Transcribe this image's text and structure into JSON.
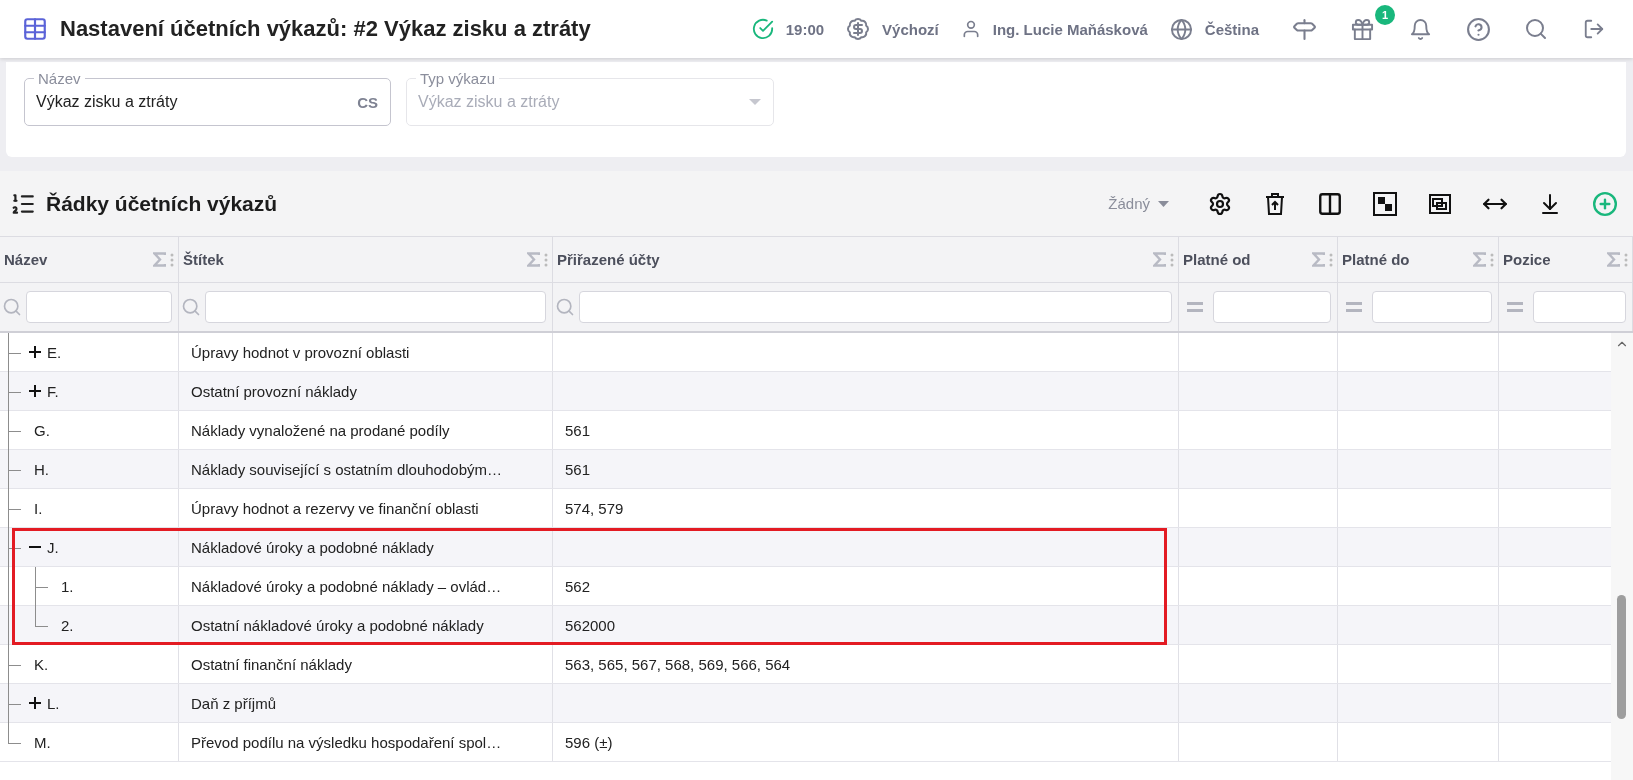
{
  "header": {
    "title": "Nastavení účetních výkazů: #2 Výkaz zisku a ztráty",
    "time": "19:00",
    "currency": "Výchozí",
    "user": "Ing. Lucie Maňásková",
    "language": "Čeština",
    "gift_badge": "1"
  },
  "form": {
    "fields": [
      {
        "kind": "text",
        "label": "Název",
        "value": "Výkaz zisku a ztráty",
        "suffix": "CS",
        "disabled": false
      },
      {
        "kind": "select",
        "label": "Typ výkazu",
        "value": "Výkaz zisku a ztráty",
        "disabled": true
      }
    ]
  },
  "section": {
    "title": "Řádky účetních výkazů",
    "grouping": "Žádný"
  },
  "table": {
    "columns": [
      {
        "label": "Název",
        "kind": "search"
      },
      {
        "label": "Štítek",
        "kind": "search"
      },
      {
        "label": "Přiřazené účty",
        "kind": "search"
      },
      {
        "label": "Platné od",
        "kind": "equals"
      },
      {
        "label": "Platné do",
        "kind": "equals"
      },
      {
        "label": "Pozice",
        "kind": "equals"
      }
    ],
    "rows": [
      {
        "code": "E.",
        "label": "Úpravy hodnot v provozní oblasti",
        "expanded": false,
        "highlighted": false
      },
      {
        "code": "F.",
        "label": "Ostatní provozní náklady",
        "expanded": false,
        "highlighted": false
      },
      {
        "code": "G.",
        "label": "Náklady vynaložené na prodané podíly",
        "accounts": "561",
        "highlighted": false
      },
      {
        "code": "H.",
        "label": "Náklady související s ostatním dlouhodobým…",
        "accounts": "561",
        "highlighted": false
      },
      {
        "code": "I.",
        "label": "Úpravy hodnot a rezervy ve finanční oblasti",
        "accounts": "574, 579",
        "highlighted": false
      },
      {
        "code": "J.",
        "label": "Nákladové úroky a podobné náklady",
        "expanded": true,
        "highlighted": true,
        "children": [
          {
            "code": "1.",
            "label": "Nákladové úroky a podobné náklady – ovlád…",
            "accounts": "562",
            "highlighted": true
          },
          {
            "code": "2.",
            "label": "Ostatní nákladové úroky a podobné náklady",
            "accounts": "562000",
            "highlighted": true
          }
        ]
      },
      {
        "code": "K.",
        "label": "Ostatní finanční náklady",
        "accounts": "563, 565, 567, 568, 569, 566, 564",
        "highlighted": false
      },
      {
        "code": "L.",
        "label": "Daň z příjmů",
        "expanded": false,
        "highlighted": false
      },
      {
        "code": "M.",
        "label": "Převod podílu na výsledku hospodaření spol…",
        "accounts": "596 (±)",
        "highlighted": false
      }
    ]
  }
}
